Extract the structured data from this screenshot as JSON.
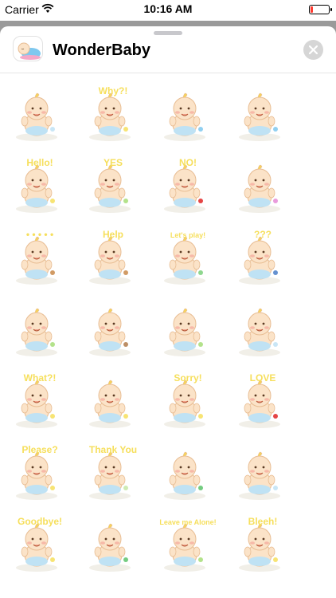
{
  "status_bar": {
    "carrier": "Carrier",
    "time": "10:16 AM",
    "battery_level": 0.12,
    "battery_color": "#ff3b30"
  },
  "header": {
    "app_name": "WonderBaby",
    "app_icon": "baby-sleeping-icon",
    "close_icon": "close-icon"
  },
  "colors": {
    "skin": "#fbe3c8",
    "outline": "#e8bd93",
    "caption_yellow": "#f6df5c",
    "diaper_blue": "#bfe2f4",
    "accent_red": "#e02424",
    "blanket_green": "#a6dd77"
  },
  "stickers": [
    {
      "id": "bottle",
      "caption": "",
      "accent": "#bfe2f4"
    },
    {
      "id": "why",
      "caption": "Why?!",
      "accent": "#f6df5c"
    },
    {
      "id": "crying",
      "caption": "",
      "accent": "#7ec8ef"
    },
    {
      "id": "sleeping",
      "caption": "",
      "accent": "#7ec8ef"
    },
    {
      "id": "hello",
      "caption": "Hello!",
      "accent": "#f6df5c"
    },
    {
      "id": "yes",
      "caption": "YES",
      "accent": "#a6dd77"
    },
    {
      "id": "no",
      "caption": "NO!",
      "accent": "#e02424"
    },
    {
      "id": "bath",
      "caption": "",
      "accent": "#e58ad6"
    },
    {
      "id": "dots",
      "caption": "• • • • •",
      "accent": "#c98a4a"
    },
    {
      "id": "help",
      "caption": "Help",
      "accent": "#c98a4a"
    },
    {
      "id": "lets-play",
      "caption": "Let's play!",
      "accent": "#7bd07b"
    },
    {
      "id": "phone",
      "caption": "???",
      "accent": "#4a7ec8"
    },
    {
      "id": "blanket",
      "caption": "",
      "accent": "#a6dd77"
    },
    {
      "id": "cookie",
      "caption": "",
      "accent": "#b07a4a"
    },
    {
      "id": "eating",
      "caption": "",
      "accent": "#a6dd77"
    },
    {
      "id": "hurt",
      "caption": "",
      "accent": "#bfe2f4"
    },
    {
      "id": "what",
      "caption": "What?!",
      "accent": "#f6df5c"
    },
    {
      "id": "idea",
      "caption": "",
      "accent": "#f6df5c"
    },
    {
      "id": "sorry",
      "caption": "Sorry!",
      "accent": "#f6df5c"
    },
    {
      "id": "love",
      "caption": "LOVE",
      "accent": "#e02424"
    },
    {
      "id": "please",
      "caption": "Please?",
      "accent": "#f6df5c"
    },
    {
      "id": "thank-you",
      "caption": "Thank You",
      "accent": "#c6e8a6"
    },
    {
      "id": "money",
      "caption": "",
      "accent": "#5cc36b"
    },
    {
      "id": "dreaming",
      "caption": "",
      "accent": "#bfe2f4"
    },
    {
      "id": "goodbye",
      "caption": "Goodbye!",
      "accent": "#f6df5c"
    },
    {
      "id": "angry",
      "caption": "",
      "accent": "#5cc36b"
    },
    {
      "id": "leave-me-alone",
      "caption": "Leave me Alone!",
      "accent": "#a6dd77"
    },
    {
      "id": "bleeh",
      "caption": "Bleeh!",
      "accent": "#f6df5c"
    }
  ]
}
